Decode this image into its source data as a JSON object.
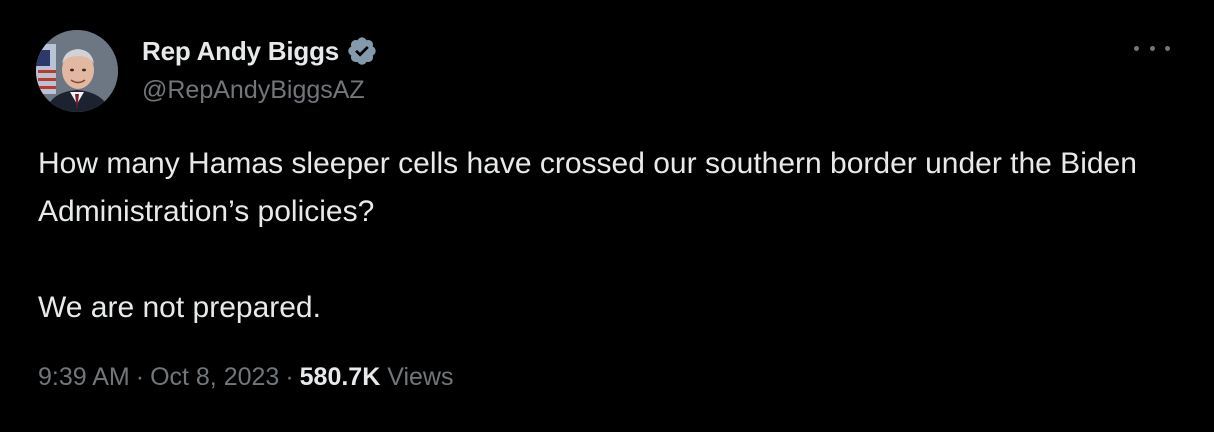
{
  "author": {
    "display_name": "Rep Andy Biggs",
    "handle": "@RepAndyBiggsAZ",
    "verified_icon": "verified-badge-icon",
    "avatar_icon": "profile-photo"
  },
  "tweet": {
    "paragraph_1": "How many Hamas sleeper cells have crossed our southern border under the Biden Administration’s policies?",
    "paragraph_2": "We are not prepared."
  },
  "meta": {
    "time": "9:39 AM",
    "separator": "·",
    "date": "Oct 8, 2023",
    "views_count": "580.7K",
    "views_label": "Views"
  },
  "menu_icon": "more-options-icon",
  "colors": {
    "background": "#000000",
    "primary_text": "#e7e9ea",
    "secondary_text": "#71767b",
    "verified": "#829aab"
  }
}
